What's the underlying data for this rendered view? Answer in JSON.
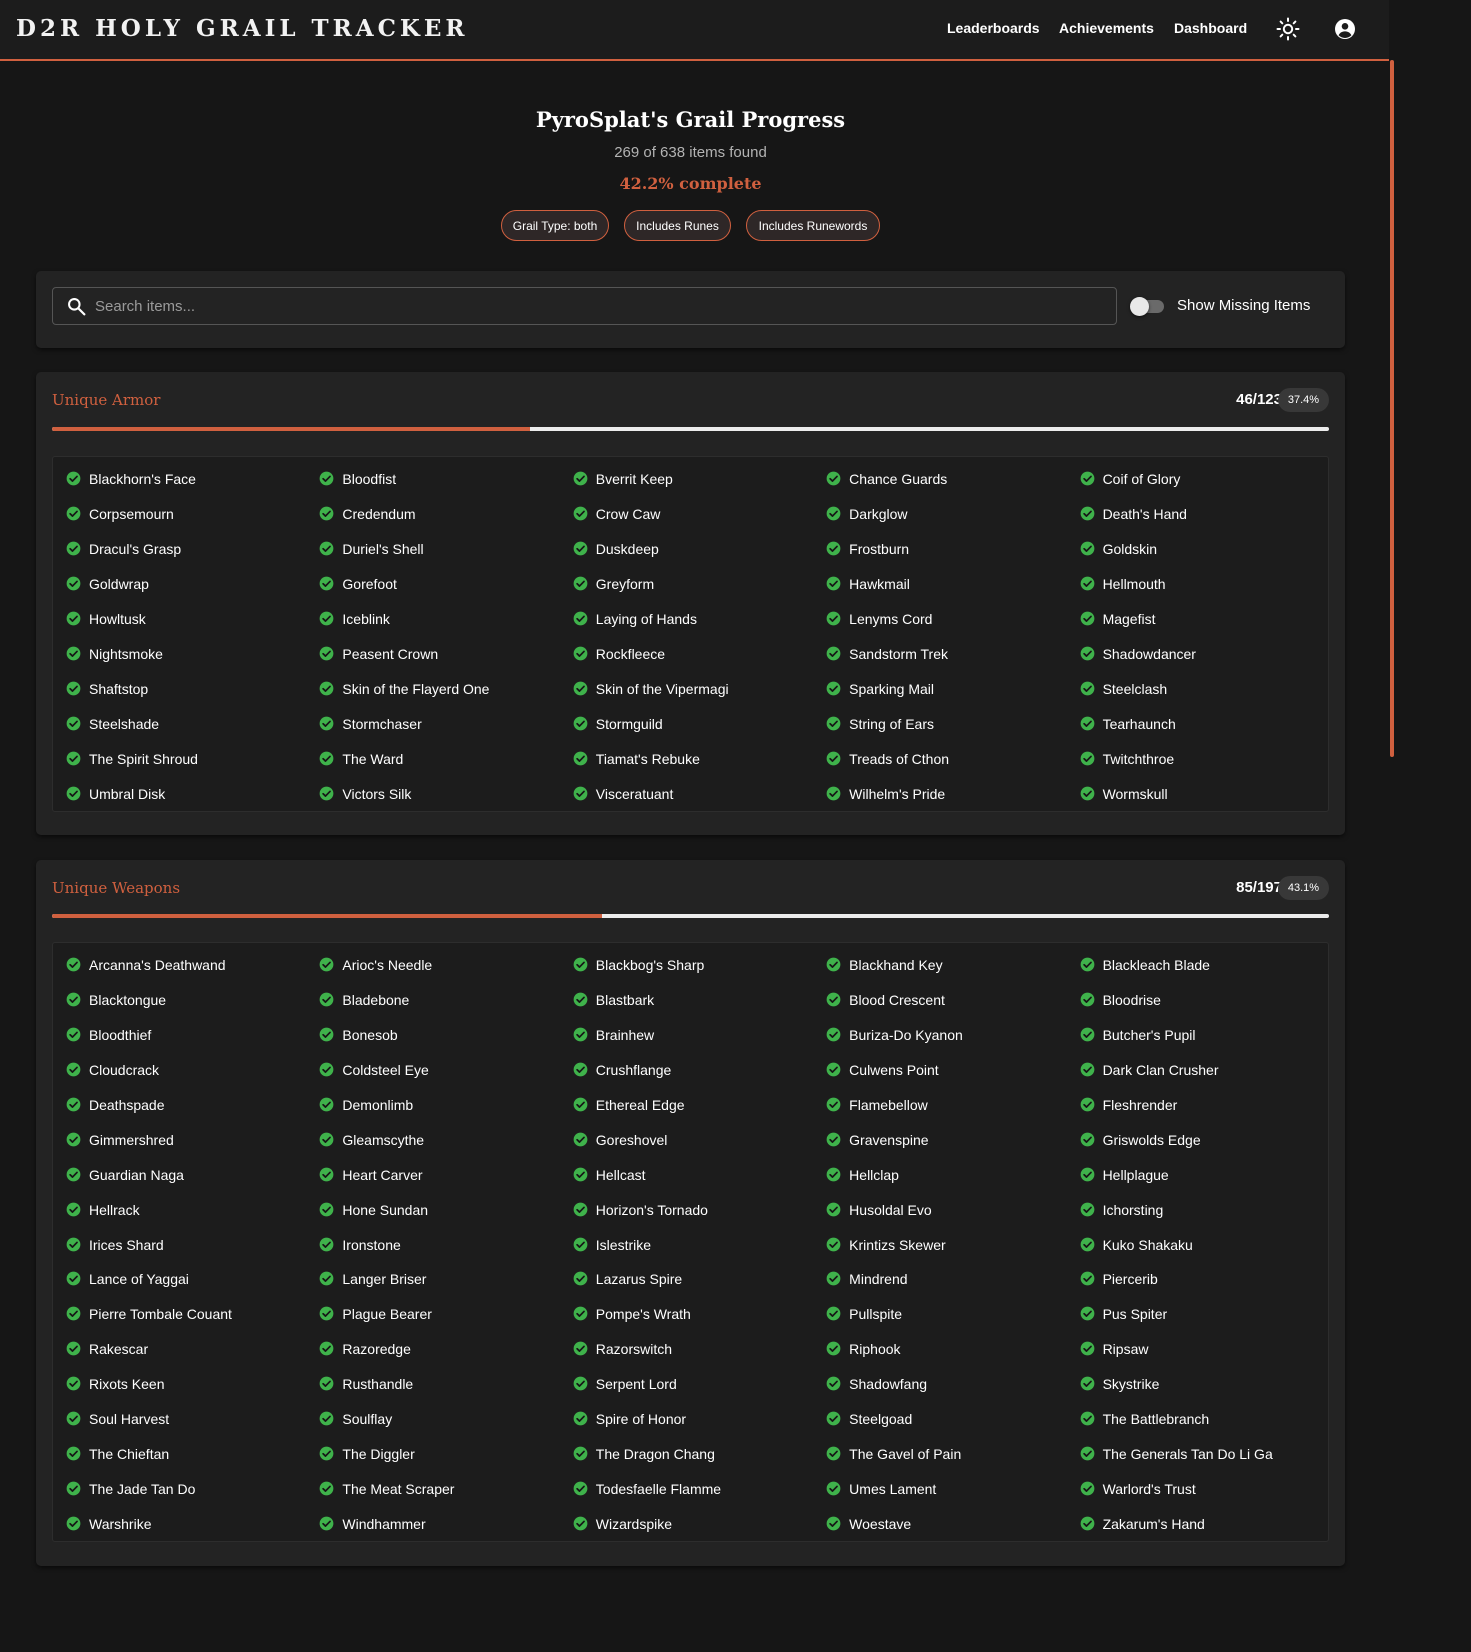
{
  "app": {
    "logo": "D2R HOLY GRAIL TRACKER",
    "nav": [
      "Leaderboards",
      "Achievements",
      "Dashboard"
    ],
    "icons": [
      "sun-icon",
      "account-icon"
    ]
  },
  "header": {
    "title": "PyroSplat's Grail Progress",
    "subtitle": "269 of 638 items found",
    "percent": "42.2% complete",
    "chips": [
      "Grail Type: both",
      "Includes Runes",
      "Includes Runewords"
    ]
  },
  "search": {
    "placeholder": "Search items...",
    "value": "",
    "toggle_label": "Show Missing Items",
    "toggle_on": false
  },
  "colors": {
    "accent": "#d0603f",
    "found": "#3fb24b",
    "background": "#161616",
    "card": "#232323"
  },
  "sections": [
    {
      "title": "Unique Armor",
      "count": "46/123",
      "percent": "37.4%",
      "progress": 0.374,
      "items": [
        "Blackhorn's Face",
        "Bloodfist",
        "Bverrit Keep",
        "Chance Guards",
        "Coif of Glory",
        "Corpsemourn",
        "Credendum",
        "Crow Caw",
        "Darkglow",
        "Death's Hand",
        "Dracul's Grasp",
        "Duriel's Shell",
        "Duskdeep",
        "Frostburn",
        "Goldskin",
        "Goldwrap",
        "Gorefoot",
        "Greyform",
        "Hawkmail",
        "Hellmouth",
        "Howltusk",
        "Iceblink",
        "Laying of Hands",
        "Lenyms Cord",
        "Magefist",
        "Nightsmoke",
        "Peasent Crown",
        "Rockfleece",
        "Sandstorm Trek",
        "Shadowdancer",
        "Shaftstop",
        "Skin of the Flayerd One",
        "Skin of the Vipermagi",
        "Sparking Mail",
        "Steelclash",
        "Steelshade",
        "Stormchaser",
        "Stormguild",
        "String of Ears",
        "Tearhaunch",
        "The Spirit Shroud",
        "The Ward",
        "Tiamat's Rebuke",
        "Treads of Cthon",
        "Twitchthroe",
        "Umbral Disk",
        "Victors Silk",
        "Visceratuant",
        "Wilhelm's Pride",
        "Wormskull"
      ]
    },
    {
      "title": "Unique Weapons",
      "count": "85/197",
      "percent": "43.1%",
      "progress": 0.431,
      "items": [
        "Arcanna's Deathwand",
        "Arioc's Needle",
        "Blackbog's Sharp",
        "Blackhand Key",
        "Blackleach Blade",
        "Blacktongue",
        "Bladebone",
        "Blastbark",
        "Blood Crescent",
        "Bloodrise",
        "Bloodthief",
        "Bonesob",
        "Brainhew",
        "Buriza-Do Kyanon",
        "Butcher's Pupil",
        "Cloudcrack",
        "Coldsteel Eye",
        "Crushflange",
        "Culwens Point",
        "Dark Clan Crusher",
        "Deathspade",
        "Demonlimb",
        "Ethereal Edge",
        "Flamebellow",
        "Fleshrender",
        "Gimmershred",
        "Gleamscythe",
        "Goreshovel",
        "Gravenspine",
        "Griswolds Edge",
        "Guardian Naga",
        "Heart Carver",
        "Hellcast",
        "Hellclap",
        "Hellplague",
        "Hellrack",
        "Hone Sundan",
        "Horizon's Tornado",
        "Husoldal Evo",
        "Ichorsting",
        "Irices Shard",
        "Ironstone",
        "Islestrike",
        "Krintizs Skewer",
        "Kuko Shakaku",
        "Lance of Yaggai",
        "Langer Briser",
        "Lazarus Spire",
        "Mindrend",
        "Piercerib",
        "Pierre Tombale Couant",
        "Plague Bearer",
        "Pompe's Wrath",
        "Pullspite",
        "Pus Spiter",
        "Rakescar",
        "Razoredge",
        "Razorswitch",
        "Riphook",
        "Ripsaw",
        "Rixots Keen",
        "Rusthandle",
        "Serpent Lord",
        "Shadowfang",
        "Skystrike",
        "Soul Harvest",
        "Soulflay",
        "Spire of Honor",
        "Steelgoad",
        "The Battlebranch",
        "The Chieftan",
        "The Diggler",
        "The Dragon Chang",
        "The Gavel of Pain",
        "The Generals Tan Do Li Ga",
        "The Jade Tan Do",
        "The Meat Scraper",
        "Todesfaelle Flamme",
        "Umes Lament",
        "Warlord's Trust",
        "Warshrike",
        "Windhammer",
        "Wizardspike",
        "Woestave",
        "Zakarum's Hand"
      ]
    }
  ]
}
